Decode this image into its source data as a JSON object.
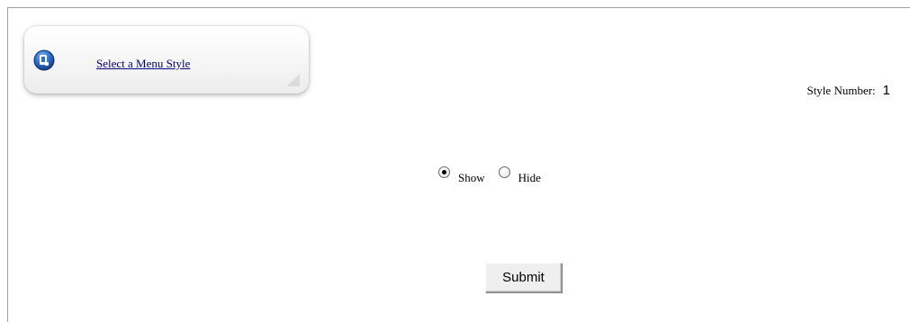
{
  "menu": {
    "link_label": "Select a Menu Style",
    "icon": "menu-icon",
    "accent_color": "#1f5fb0"
  },
  "style_number": {
    "label": "Style Number:",
    "value": "1"
  },
  "visibility": {
    "options": [
      {
        "label": "Show",
        "checked": true
      },
      {
        "label": "Hide",
        "checked": false
      }
    ]
  },
  "form": {
    "submit_label": "Submit"
  }
}
